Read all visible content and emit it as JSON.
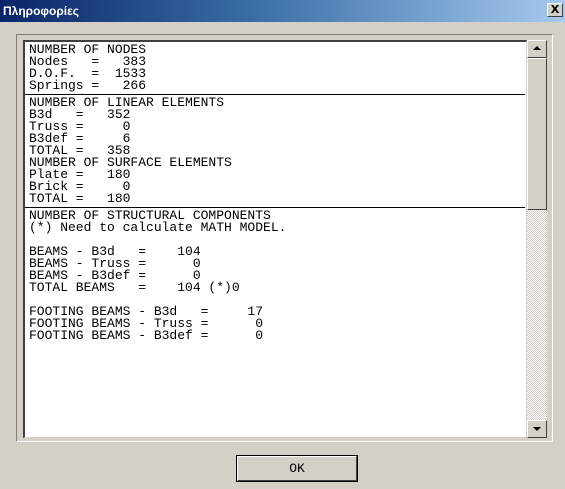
{
  "window": {
    "title": "Πληροφορίες",
    "close_label": "X"
  },
  "sections": [
    {
      "lines": [
        "NUMBER OF NODES",
        "Nodes   =   383",
        "D.O.F.  =  1533",
        "Springs =   266"
      ]
    },
    {
      "lines": [
        "NUMBER OF LINEAR ELEMENTS",
        "B3d   =   352",
        "Truss =     0",
        "B3def =     6",
        "TOTAL =   358",
        "NUMBER OF SURFACE ELEMENTS",
        "Plate =   180",
        "Brick =     0",
        "TOTAL =   180"
      ]
    },
    {
      "lines": [
        "NUMBER OF STRUCTURAL COMPONENTS",
        "(*) Need to calculate MATH MODEL.",
        "",
        "BEAMS - B3d   =    104",
        "BEAMS - Truss =      0",
        "BEAMS - B3def =      0",
        "TOTAL BEAMS   =    104 (*)0",
        "",
        "FOOTING BEAMS - B3d   =     17",
        "FOOTING BEAMS - Truss =      0",
        "FOOTING BEAMS - B3def =      0"
      ]
    }
  ],
  "buttons": {
    "ok_label": "OK"
  },
  "colors": {
    "titlebar_start": "#0a246a",
    "titlebar_end": "#a6caf0",
    "dialog_face": "#d4d0c8"
  }
}
